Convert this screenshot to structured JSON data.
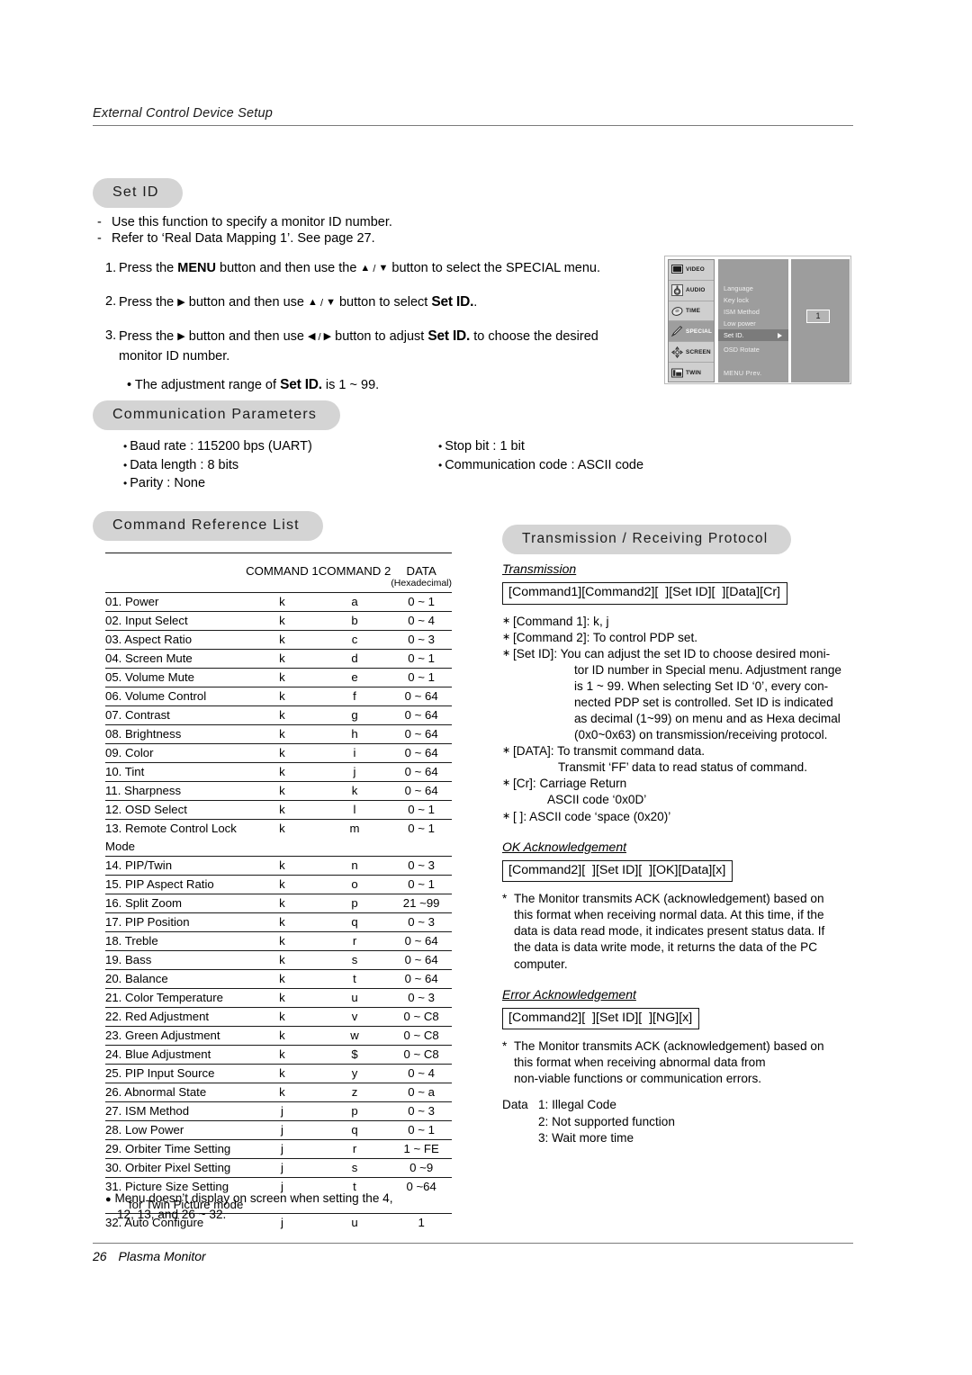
{
  "header": {
    "title": "External Control Device Setup"
  },
  "set_id": {
    "heading": "Set ID",
    "dashes": [
      "Use this function to specify a monitor ID number.",
      "Refer to ‘Real Data Mapping 1’. See page 27."
    ],
    "steps": [
      {
        "num": "1.",
        "parts": [
          {
            "t": "Press the ",
            "s": "plain"
          },
          {
            "t": "MENU",
            "s": "bold"
          },
          {
            "t": " button and then use the ",
            "s": "plain"
          },
          {
            "t": "▲",
            "s": "arrow"
          },
          {
            "t": " / ",
            "s": "slash"
          },
          {
            "t": "▼",
            "s": "arrow"
          },
          {
            "t": " button to select the SPECIAL menu.",
            "s": "plain"
          }
        ]
      },
      {
        "num": "2.",
        "parts": [
          {
            "t": "Press the ",
            "s": "plain"
          },
          {
            "t": "▶",
            "s": "arrow"
          },
          {
            "t": " button and then use ",
            "s": "plain"
          },
          {
            "t": "▲",
            "s": "arrow"
          },
          {
            "t": " / ",
            "s": "slash"
          },
          {
            "t": "▼",
            "s": "arrow"
          },
          {
            "t": " button to select ",
            "s": "plain"
          },
          {
            "t": "Set ID.",
            "s": "setid"
          },
          {
            "t": ".",
            "s": "plain"
          }
        ]
      },
      {
        "num": "3.",
        "parts": [
          {
            "t": "Press the ",
            "s": "plain"
          },
          {
            "t": "▶",
            "s": "arrow"
          },
          {
            "t": " button and then use ",
            "s": "plain"
          },
          {
            "t": "◀",
            "s": "arrow"
          },
          {
            "t": " / ",
            "s": "slash"
          },
          {
            "t": "▶",
            "s": "arrow"
          },
          {
            "t": " button to adjust ",
            "s": "plain"
          },
          {
            "t": "Set ID.",
            "s": "setid"
          },
          {
            "t": " to choose the desired",
            "s": "plain"
          },
          {
            "t": "BREAK",
            "s": "br"
          },
          {
            "t": "monitor ID number.",
            "s": "plain"
          }
        ]
      }
    ],
    "sub_bullet": [
      {
        "t": "• The adjustment range of ",
        "s": "plain"
      },
      {
        "t": "Set ID.",
        "s": "setid"
      },
      {
        "t": " is 1 ~ 99.",
        "s": "plain"
      }
    ]
  },
  "osd": {
    "tabs": [
      {
        "label": "VIDEO",
        "icon": "video-icon",
        "active": false
      },
      {
        "label": "AUDIO",
        "icon": "audio-icon",
        "active": false
      },
      {
        "label": "TIME",
        "icon": "time-icon",
        "active": false
      },
      {
        "label": "SPECIAL",
        "icon": "special-icon",
        "active": true
      },
      {
        "label": "SCREEN",
        "icon": "screen-icon",
        "active": false
      },
      {
        "label": "TWIN",
        "icon": "twin-icon",
        "active": false
      }
    ],
    "items": [
      {
        "label": "Language",
        "selected": false,
        "gap": false
      },
      {
        "label": "Key lock",
        "selected": false,
        "gap": false
      },
      {
        "label": "ISM Method",
        "selected": false,
        "gap": false
      },
      {
        "label": "Low power",
        "selected": false,
        "gap": false
      },
      {
        "label": "Set ID.",
        "selected": true,
        "gap": false
      },
      {
        "label": "OSD Rotate",
        "selected": false,
        "gap": true
      }
    ],
    "menu_footer": "MENU  Prev.",
    "value": "1"
  },
  "communication": {
    "heading": "Communication Parameters",
    "left": [
      "Baud rate : 115200 bps (UART)",
      "Data length : 8 bits",
      "Parity : None"
    ],
    "right": [
      "Stop bit : 1 bit",
      "Communication code : ASCII code"
    ]
  },
  "command_list": {
    "heading": "Command Reference List",
    "columns": [
      "",
      "COMMAND 1",
      "COMMAND 2",
      "DATA"
    ],
    "data_sub": "(Hexadecimal)",
    "rows": [
      {
        "name": "01. Power",
        "c1": "k",
        "c2": "a",
        "data": "0 ~ 1"
      },
      {
        "name": "02. Input Select",
        "c1": "k",
        "c2": "b",
        "data": "0 ~ 4"
      },
      {
        "name": "03. Aspect Ratio",
        "c1": "k",
        "c2": "c",
        "data": "0 ~ 3"
      },
      {
        "name": "04. Screen Mute",
        "c1": "k",
        "c2": "d",
        "data": "0 ~ 1"
      },
      {
        "name": "05. Volume Mute",
        "c1": "k",
        "c2": "e",
        "data": "0 ~ 1"
      },
      {
        "name": "06. Volume Control",
        "c1": "k",
        "c2": "f",
        "data": "0 ~ 64"
      },
      {
        "name": "07. Contrast",
        "c1": "k",
        "c2": "g",
        "data": "0 ~ 64"
      },
      {
        "name": "08. Brightness",
        "c1": "k",
        "c2": "h",
        "data": "0 ~ 64"
      },
      {
        "name": "09. Color",
        "c1": "k",
        "c2": "i",
        "data": "0 ~ 64"
      },
      {
        "name": "10. Tint",
        "c1": "k",
        "c2": "j",
        "data": "0 ~ 64"
      },
      {
        "name": "11. Sharpness",
        "c1": "k",
        "c2": "k",
        "data": "0 ~ 64"
      },
      {
        "name": "12. OSD Select",
        "c1": "k",
        "c2": "l",
        "data": "0 ~ 1"
      },
      {
        "name": "13. Remote Control Lock Mode",
        "c1": "k",
        "c2": "m",
        "data": "0 ~ 1"
      },
      {
        "name": "14. PIP/Twin",
        "c1": "k",
        "c2": "n",
        "data": "0 ~ 3"
      },
      {
        "name": "15. PIP Aspect Ratio",
        "c1": "k",
        "c2": "o",
        "data": "0 ~ 1"
      },
      {
        "name": "16. Split Zoom",
        "c1": "k",
        "c2": "p",
        "data": "21 ~99"
      },
      {
        "name": "17. PIP Position",
        "c1": "k",
        "c2": "q",
        "data": "0 ~ 3"
      },
      {
        "name": "18. Treble",
        "c1": "k",
        "c2": "r",
        "data": "0 ~ 64"
      },
      {
        "name": "19. Bass",
        "c1": "k",
        "c2": "s",
        "data": "0 ~ 64"
      },
      {
        "name": "20. Balance",
        "c1": "k",
        "c2": "t",
        "data": "0 ~ 64"
      },
      {
        "name": "21. Color Temperature",
        "c1": "k",
        "c2": "u",
        "data": "0 ~ 3"
      },
      {
        "name": "22. Red Adjustment",
        "c1": "k",
        "c2": "v",
        "data": "0 ~ C8"
      },
      {
        "name": "23. Green Adjustment",
        "c1": "k",
        "c2": "w",
        "data": "0 ~ C8"
      },
      {
        "name": "24. Blue Adjustment",
        "c1": "k",
        "c2": "$",
        "data": "0 ~ C8"
      },
      {
        "name": "25. PIP Input Source",
        "c1": "k",
        "c2": "y",
        "data": "0 ~ 4"
      },
      {
        "name": "26. Abnormal State",
        "c1": "k",
        "c2": "z",
        "data": "0 ~ a"
      },
      {
        "name": "27. ISM Method",
        "c1": "j",
        "c2": "p",
        "data": "0 ~ 3"
      },
      {
        "name": "28. Low Power",
        "c1": "j",
        "c2": "q",
        "data": "0 ~ 1"
      },
      {
        "name": "29. Orbiter Time Setting",
        "c1": "j",
        "c2": "r",
        "data": "1 ~ FE"
      },
      {
        "name": "30. Orbiter Pixel Setting",
        "c1": "j",
        "c2": "s",
        "data": "0 ~9"
      },
      {
        "name": "31. Picture Size Setting",
        "c1": "j",
        "c2": "t",
        "data": "0 ~64"
      },
      {
        "name": "for Twin Picture mode",
        "c1": "",
        "c2": "",
        "data": "",
        "continuation": true
      },
      {
        "name": "32. Auto Configure",
        "c1": "j",
        "c2": "u",
        "data": "1"
      }
    ],
    "note_line1": "Menu doesn’t display on screen when setting the 4,",
    "note_line2": "12, 13, and 26 ~ 32."
  },
  "protocol": {
    "heading": "Transmission / Receiving  Protocol",
    "transmission": {
      "title": "Transmission",
      "code": "[Command1][Command2][  ][Set ID][  ][Data][Cr]",
      "bullets": [
        {
          "text": "[Command 1]: k, j",
          "hang": []
        },
        {
          "text": "[Command 2]: To control PDP set.",
          "hang": []
        },
        {
          "text": "[Set ID]: You can adjust the set ID to choose desired moni-",
          "hang": [
            "tor ID number in Special menu. Adjustment range",
            "is 1 ~ 99. When selecting Set ID ‘0’, every con-",
            "nected PDP set is controlled. Set ID is indicated",
            "as decimal (1~99) on menu and as Hexa decimal",
            "(0x0~0x63) on transmission/receiving protocol."
          ],
          "hang_class": "hang"
        },
        {
          "text": "[DATA]: To transmit command data.",
          "hang": [
            "Transmit ‘FF’ data to read status of command."
          ],
          "hang_class": "hang2"
        },
        {
          "text": "[Cr]: Carriage Return",
          "hang": [
            "ASCII code ‘0x0D’"
          ],
          "hang_class": "hang3"
        },
        {
          "text": "[  ]: ASCII code ‘space (0x20)’",
          "hang": []
        }
      ]
    },
    "ok_ack": {
      "title": "OK Acknowledgement",
      "code": "[Command2][  ][Set ID][  ][OK][Data][x]",
      "note_mark": "*",
      "note_lines": [
        "The Monitor transmits ACK (acknowledgement) based on",
        "this format when receiving normal data. At this time, if the",
        "data is data read mode, it indicates present status data. If",
        "the data is data write mode, it returns the data of the PC",
        "computer."
      ]
    },
    "error_ack": {
      "title": "Error Acknowledgement",
      "code": "[Command2][  ][Set ID][  ][NG][x]",
      "note_mark": "*",
      "note_lines": [
        "The Monitor transmits ACK (acknowledgement) based on",
        "this format when receiving abnormal data from",
        "non-viable functions or communication errors."
      ],
      "data_label": "Data",
      "data_items": [
        "1: Illegal Code",
        "2: Not supported function",
        "3: Wait more time"
      ]
    }
  },
  "footer": {
    "page": "26",
    "label": "Plasma Monitor"
  }
}
